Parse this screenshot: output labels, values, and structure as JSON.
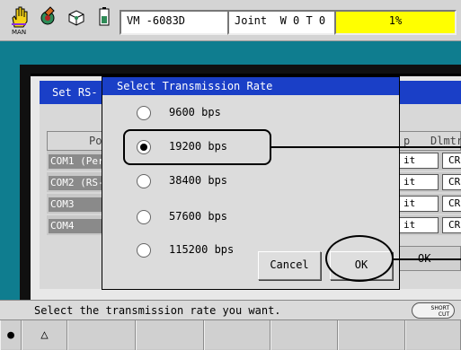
{
  "status_bar": {
    "man_label": "MAN",
    "program_label": "VM -6083D",
    "coord_label": "Joint  W 0 T 0",
    "speed_label": "1%",
    "speed_color": "#ffff00",
    "icons": [
      "hand-icon",
      "robot-arm-icon",
      "cube-icon",
      "battery-icon"
    ]
  },
  "background_window": {
    "title": "Set RS-",
    "header_left": "Po",
    "header_p": "p",
    "header_dlmt": "Dlmtr",
    "rows": [
      {
        "label": "COM1 (Per",
        "c1": "it",
        "c2": "CR"
      },
      {
        "label": "COM2 (RS-",
        "c1": "it",
        "c2": "CR"
      },
      {
        "label": "COM3",
        "c1": "it",
        "c2": "CR"
      },
      {
        "label": "COM4",
        "c1": "it",
        "c2": "CR"
      }
    ],
    "ok_label": "OK"
  },
  "dialog": {
    "title": "Select Transmission Rate",
    "options": [
      {
        "label": "9600 bps",
        "selected": false
      },
      {
        "label": "19200 bps",
        "selected": true
      },
      {
        "label": "38400 bps",
        "selected": false
      },
      {
        "label": "57600 bps",
        "selected": false
      },
      {
        "label": "115200 bps",
        "selected": false
      }
    ],
    "cancel_label": "Cancel",
    "ok_label": "OK"
  },
  "message": {
    "text": "Select the transmission rate you want.",
    "shortcut_line1": "SHORT",
    "shortcut_line2": "CUT"
  },
  "function_keys": {
    "key1_symbol": "●",
    "key2_symbol": "△"
  },
  "colors": {
    "screen_background": "#0f7d8f",
    "title_bar": "#1a3fc7"
  }
}
